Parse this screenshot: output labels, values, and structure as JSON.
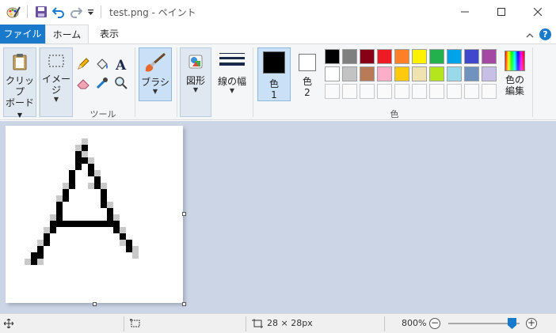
{
  "window": {
    "title": "test.png - ペイント"
  },
  "tabs": {
    "file": "ファイル",
    "home": "ホーム",
    "view": "表示"
  },
  "ribbon": {
    "clipboard": {
      "line1": "クリップ",
      "line2": "ボード"
    },
    "image": {
      "label": "イメージ"
    },
    "tools": {
      "group_label": "ツール"
    },
    "brushes": {
      "label": "ブラシ"
    },
    "shapes": {
      "label": "図形"
    },
    "size": {
      "label": "線の幅"
    },
    "color1": {
      "line1": "色",
      "line2": "1",
      "value": "#000000"
    },
    "color2": {
      "line1": "色",
      "line2": "2",
      "value": "#ffffff"
    },
    "colors": {
      "group_label": "色"
    },
    "edit_colors": {
      "line1": "色の",
      "line2": "編集"
    },
    "palette": [
      "#000000",
      "#7f7f7f",
      "#880015",
      "#ed1c24",
      "#ff7f27",
      "#fff200",
      "#22b14c",
      "#00a2e8",
      "#3f48cc",
      "#a349a4",
      "#ffffff",
      "#c3c3c3",
      "#b97a57",
      "#ffaec9",
      "#ffc90e",
      "#efe4b0",
      "#b5e61d",
      "#99d9ea",
      "#7092be",
      "#c8bfe7"
    ]
  },
  "status": {
    "image_size": "28 × 28px",
    "zoom": "800%",
    "zoom_level_fraction": 0.83
  },
  "drawing": {
    "grid": 28,
    "pixels_black": [
      [
        12,
        3
      ],
      [
        11,
        4
      ],
      [
        11,
        5
      ],
      [
        12,
        5
      ],
      [
        11,
        6
      ],
      [
        13,
        6
      ],
      [
        10,
        7
      ],
      [
        13,
        7
      ],
      [
        10,
        8
      ],
      [
        14,
        8
      ],
      [
        10,
        9
      ],
      [
        14,
        9
      ],
      [
        9,
        10
      ],
      [
        15,
        10
      ],
      [
        9,
        11
      ],
      [
        15,
        11
      ],
      [
        8,
        12
      ],
      [
        15,
        12
      ],
      [
        8,
        13
      ],
      [
        16,
        13
      ],
      [
        8,
        14
      ],
      [
        16,
        14
      ],
      [
        7,
        15
      ],
      [
        8,
        15
      ],
      [
        9,
        15
      ],
      [
        10,
        15
      ],
      [
        11,
        15
      ],
      [
        12,
        15
      ],
      [
        13,
        15
      ],
      [
        14,
        15
      ],
      [
        15,
        15
      ],
      [
        16,
        15
      ],
      [
        17,
        15
      ],
      [
        7,
        16
      ],
      [
        17,
        16
      ],
      [
        6,
        17
      ],
      [
        18,
        17
      ],
      [
        6,
        18
      ],
      [
        19,
        18
      ],
      [
        5,
        19
      ],
      [
        19,
        19
      ],
      [
        4,
        20
      ],
      [
        5,
        20
      ],
      [
        4,
        21
      ]
    ],
    "pixels_gray": [
      [
        12,
        2
      ],
      [
        13,
        5
      ],
      [
        11,
        3
      ],
      [
        12,
        4
      ],
      [
        14,
        7
      ],
      [
        13,
        9
      ],
      [
        9,
        9
      ],
      [
        15,
        9
      ],
      [
        8,
        11
      ],
      [
        16,
        12
      ],
      [
        7,
        14
      ],
      [
        17,
        14
      ],
      [
        6,
        16
      ],
      [
        18,
        16
      ],
      [
        5,
        18
      ],
      [
        18,
        18
      ],
      [
        20,
        19
      ],
      [
        3,
        21
      ],
      [
        5,
        21
      ],
      [
        20,
        20
      ]
    ]
  }
}
